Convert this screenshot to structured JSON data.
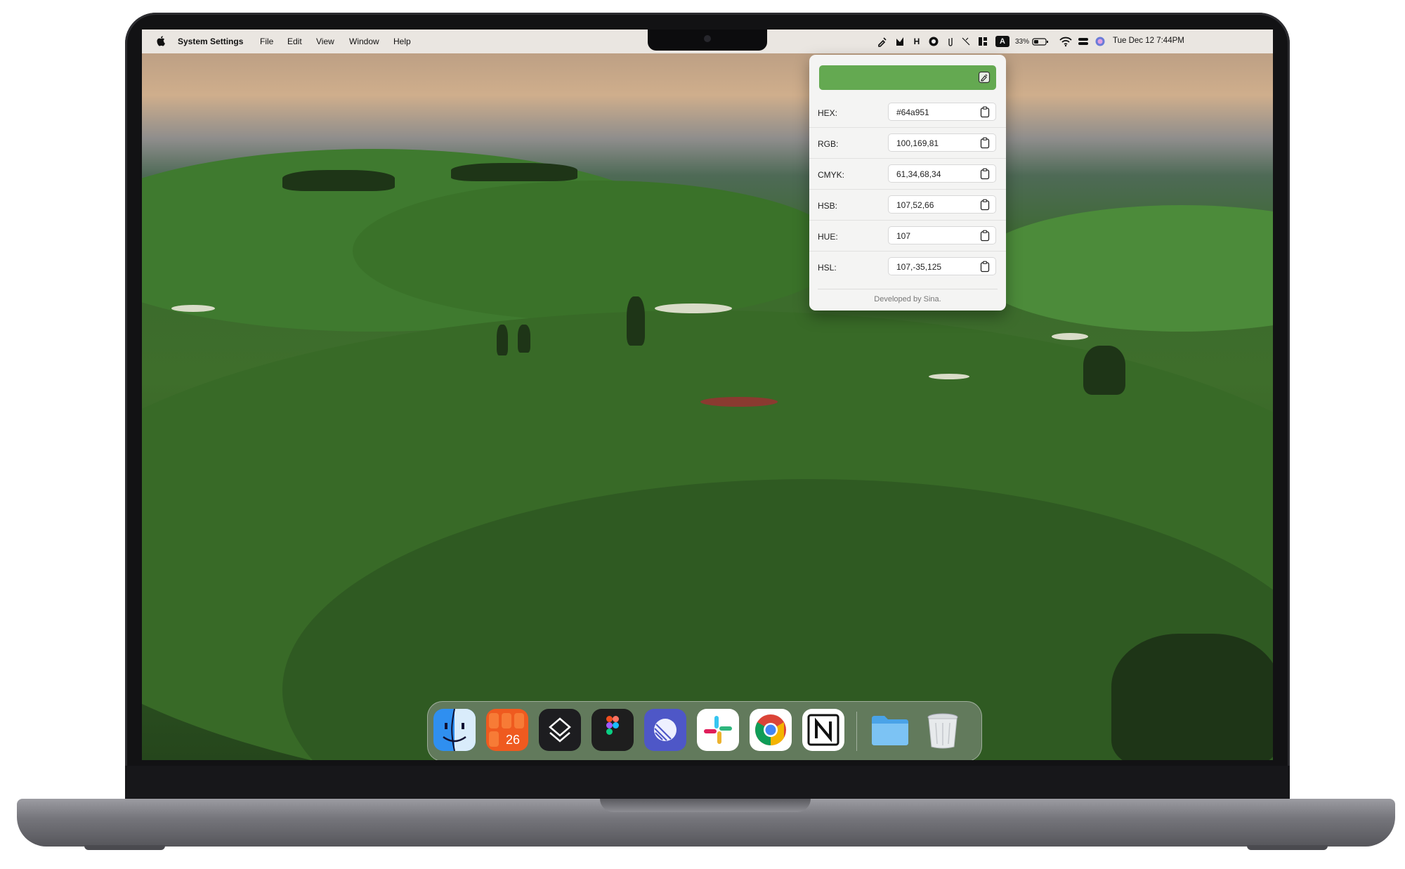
{
  "menubar": {
    "app_name": "System Settings",
    "menus": [
      "File",
      "Edit",
      "View",
      "Window",
      "Help"
    ],
    "battery": "33%",
    "datetime": "Tue Dec 12  7:44PM"
  },
  "color_picker": {
    "swatch_color": "#64a951",
    "rows": [
      {
        "label": "HEX:",
        "value": "#64a951"
      },
      {
        "label": "RGB:",
        "value": "100,169,81"
      },
      {
        "label": "CMYK:",
        "value": "61,34,68,34"
      },
      {
        "label": "HSB:",
        "value": "107,52,66"
      },
      {
        "label": "HUE:",
        "value": "107"
      },
      {
        "label": "HSL:",
        "value": "107,-35,125"
      }
    ],
    "footer": "Developed by Sina."
  },
  "dock": {
    "apps": [
      "Finder",
      "Fantastical",
      "Stacks",
      "Figma",
      "Linear",
      "Slack",
      "Google Chrome",
      "Notion",
      "Folder",
      "Trash"
    ],
    "fantastical_date": "26"
  }
}
